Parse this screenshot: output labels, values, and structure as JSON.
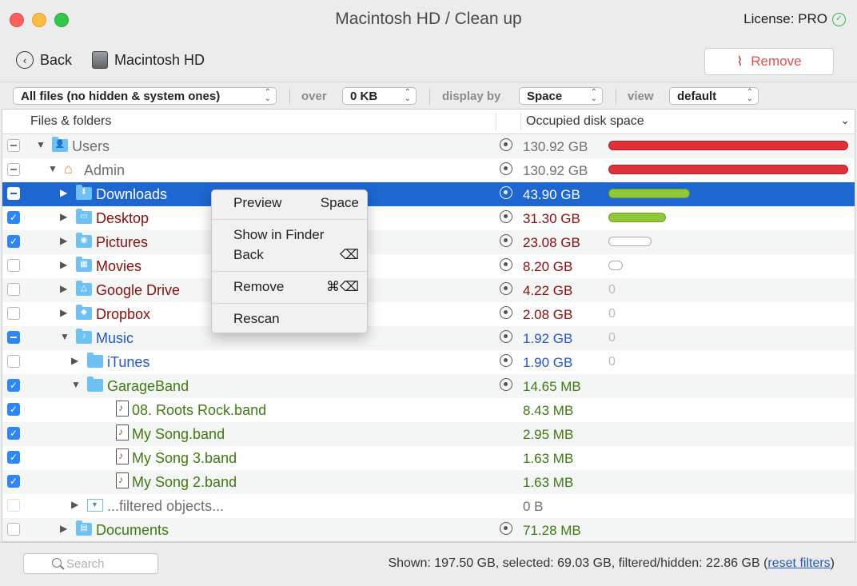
{
  "window": {
    "title": "Macintosh HD / Clean up",
    "license_label": "License: PRO"
  },
  "toolbar": {
    "back_label": "Back",
    "location_label": "Macintosh HD",
    "remove_label": "Remove"
  },
  "filters": {
    "scope_value": "All files (no hidden & system ones)",
    "over_label": "over",
    "over_value": "0 KB",
    "display_label": "display by",
    "display_value": "Space",
    "view_label": "view",
    "view_value": "default"
  },
  "table": {
    "col_files": "Files & folders",
    "col_space": "Occupied disk space",
    "rows": [
      {
        "name": "Users",
        "size": "130.92 GB",
        "check": "mixed",
        "color": "gray",
        "icon": "user-folder",
        "level": 0,
        "expanded": true,
        "bar": 1.0,
        "bar_color": "red"
      },
      {
        "name": "Admin",
        "size": "130.92 GB",
        "check": "mixed",
        "color": "gray",
        "icon": "home",
        "level": 1,
        "expanded": true,
        "bar": 1.0,
        "bar_color": "red"
      },
      {
        "name": "Downloads",
        "size": "43.90 GB",
        "check": "mixed",
        "color": "white",
        "icon": "downloads-folder",
        "level": 2,
        "expanded": false,
        "bar": 0.34,
        "bar_color": "green",
        "selected": true
      },
      {
        "name": "Desktop",
        "size": "31.30 GB",
        "check": "checked",
        "color": "red",
        "icon": "desktop-folder",
        "level": 2,
        "expanded": false,
        "bar": 0.24,
        "bar_color": "green"
      },
      {
        "name": "Pictures",
        "size": "23.08 GB",
        "check": "checked",
        "color": "red",
        "icon": "pictures-folder",
        "level": 2,
        "expanded": false,
        "bar": 0.18,
        "bar_color": "white"
      },
      {
        "name": "Movies",
        "size": "8.20 GB",
        "check": "unchecked",
        "color": "red",
        "icon": "movies-folder",
        "level": 2,
        "expanded": false,
        "bar": 0.06,
        "bar_color": "white"
      },
      {
        "name": "Google Drive",
        "size": "4.22 GB",
        "check": "unchecked",
        "color": "red",
        "icon": "drive-folder",
        "level": 2,
        "expanded": false,
        "bar_zero": "0"
      },
      {
        "name": "Dropbox",
        "size": "2.08 GB",
        "check": "unchecked",
        "color": "red",
        "icon": "dropbox-folder",
        "level": 2,
        "expanded": false,
        "bar_zero": "0"
      },
      {
        "name": "Music",
        "size": "1.92 GB",
        "check": "mixedblue",
        "color": "blue",
        "icon": "music-folder",
        "level": 2,
        "expanded": true,
        "bar_zero": "0"
      },
      {
        "name": "iTunes",
        "size": "1.90 GB",
        "check": "unchecked",
        "color": "blue",
        "icon": "folder",
        "level": 3,
        "expanded": false,
        "bar_zero": "0"
      },
      {
        "name": "GarageBand",
        "size": "14.65 MB",
        "check": "checked",
        "color": "green",
        "icon": "folder",
        "level": 3,
        "expanded": true
      },
      {
        "name": "08. Roots Rock.band",
        "size": "8.43 MB",
        "check": "checked",
        "color": "green",
        "icon": "file",
        "level": 4,
        "no_target": true
      },
      {
        "name": "My Song.band",
        "size": "2.95 MB",
        "check": "checked",
        "color": "green",
        "icon": "file",
        "level": 4,
        "no_target": true
      },
      {
        "name": "My Song 3.band",
        "size": "1.63 MB",
        "check": "checked",
        "color": "green",
        "icon": "file",
        "level": 4,
        "no_target": true
      },
      {
        "name": "My Song 2.band",
        "size": "1.63 MB",
        "check": "checked",
        "color": "green",
        "icon": "file",
        "level": 4,
        "no_target": true
      },
      {
        "name": "...filtered objects...",
        "size": "0 B",
        "check": "dim",
        "color": "gray",
        "icon": "filter",
        "level": 3,
        "expanded": false,
        "no_target": true
      },
      {
        "name": "Documents",
        "size": "71.28 MB",
        "check": "unchecked",
        "color": "green",
        "icon": "documents-folder",
        "level": 2,
        "expanded": false
      }
    ]
  },
  "context_menu": {
    "items": [
      {
        "label": "Preview",
        "shortcut": "Space"
      },
      {
        "label": "Show in Finder",
        "shortcut": ""
      },
      {
        "label": "Back",
        "shortcut": "⌫"
      },
      {
        "label": "Remove",
        "shortcut": "⌘⌫"
      },
      {
        "label": "Rescan",
        "shortcut": ""
      }
    ]
  },
  "status": {
    "search_placeholder": "Search",
    "summary": "Shown: 197.50 GB, selected: 69.03 GB, filtered/hidden: 22.86 GB (",
    "reset_link": "reset filters",
    "summary_end": ")"
  },
  "colors": {
    "selection": "#1e66d0",
    "accent": "#2f86f6",
    "bar_red": "#e0303a",
    "bar_green": "#8fc93a"
  }
}
